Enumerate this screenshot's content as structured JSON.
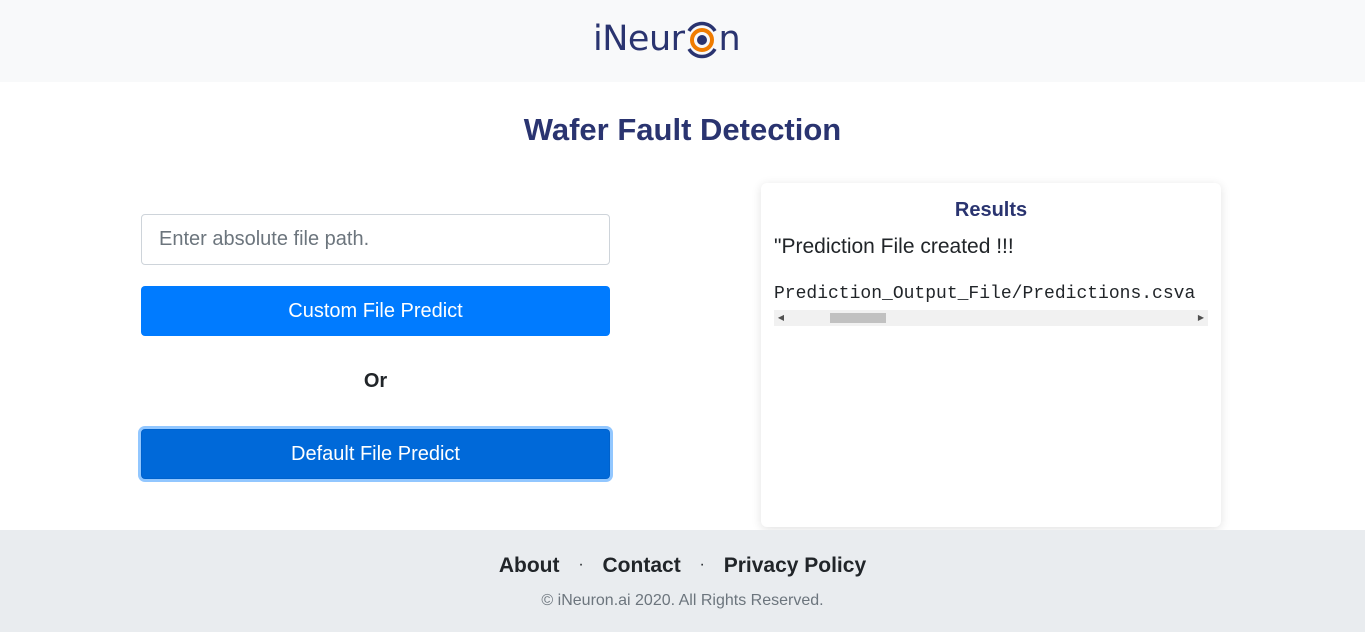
{
  "header": {
    "logo_prefix": "iNeur",
    "logo_suffix": "n",
    "logo_colors": {
      "text": "#2a3470",
      "ring": "#f07c00",
      "center": "#2a3470"
    }
  },
  "main": {
    "title": "Wafer Fault Detection",
    "path_input": {
      "placeholder": "Enter absolute file path.",
      "value": ""
    },
    "custom_button_label": "Custom File Predict",
    "or_label": "Or",
    "default_button_label": "Default File Predict"
  },
  "results": {
    "title": "Results",
    "message": "\"Prediction File created !!!",
    "output_path": "Prediction_Output_File/Predictions.csva",
    "scroll_left_arrow": "◀",
    "scroll_right_arrow": "▶"
  },
  "footer": {
    "links": [
      "About",
      "Contact",
      "Privacy Policy"
    ],
    "separator": "·",
    "copyright": "© iNeuron.ai 2020. All Rights Reserved."
  },
  "colors": {
    "primary": "#007bff",
    "primary_active": "#0069d9",
    "heading": "#2a3470",
    "footer_bg": "#e9ecef"
  }
}
